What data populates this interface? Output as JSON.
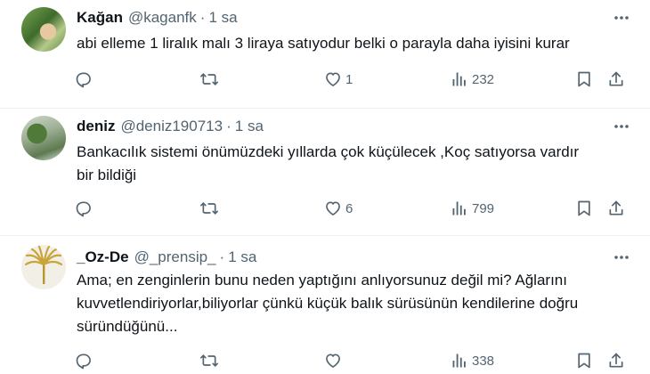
{
  "tweets": [
    {
      "name": "Kağan",
      "handle": "@kaganfk",
      "sep": "·",
      "time": "1 sa",
      "lines": [
        "abi elleme 1 liralık malı 3 liraya satıyodur belki o parayla daha iyisini kurar"
      ],
      "likes": "1",
      "views": "232"
    },
    {
      "name": "deniz",
      "handle": "@deniz190713",
      "sep": "·",
      "time": "1 sa",
      "lines": [
        "Bankacılık sistemi önümüzdeki yıllarda çok küçülecek ,Koç satıyorsa vardır",
        "bir bildiği"
      ],
      "likes": "6",
      "views": "799"
    },
    {
      "name": "_Oz-De",
      "handle": "@_prensip_",
      "sep": "·",
      "time": "1 sa",
      "lines": [
        "Ama; en zenginlerin bunu neden yaptığını anlıyorsunuz değil mi? Ağlarını",
        "kuvvetlendiriyorlar,biliyorlar çünkü küçük balık sürüsünün kendilerine doğru",
        "süründüğünü..."
      ],
      "likes": "",
      "views": "338"
    }
  ],
  "icons": {
    "reply": "reply-icon",
    "retweet": "retweet-icon",
    "like": "heart-icon",
    "views": "views-chart-icon",
    "bookmark": "bookmark-icon",
    "share": "share-icon",
    "more": "more-dots-icon"
  },
  "colors": {
    "text": "#0f1419",
    "secondary": "#536471",
    "divider": "#eff3f4"
  }
}
